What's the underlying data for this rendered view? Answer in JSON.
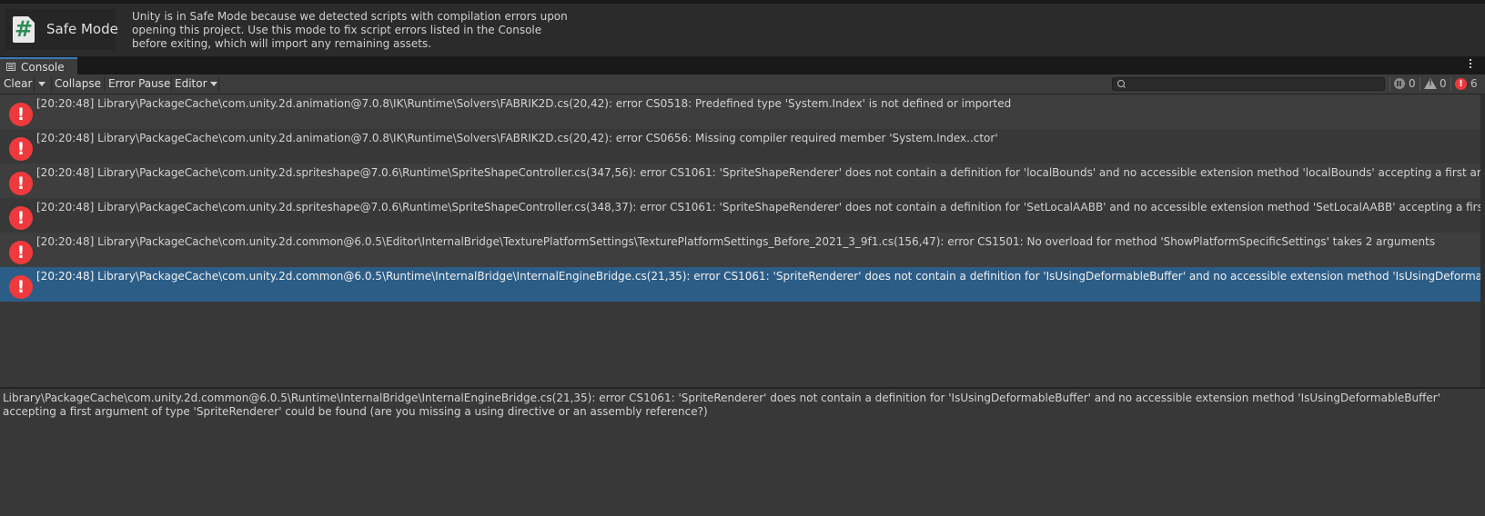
{
  "safe_mode": {
    "title": "Safe Mode",
    "icon": "hash-icon",
    "message_lines": [
      "Unity is in Safe Mode because we detected scripts with compilation errors upon",
      "opening this project. Use this mode to fix script errors listed in the Console",
      "before exiting, which will import any remaining assets."
    ]
  },
  "tab": {
    "label": "Console"
  },
  "toolbar": {
    "clear_label": "Clear",
    "collapse_label": "Collapse",
    "error_pause_label": "Error Pause",
    "editor_label": "Editor",
    "search_placeholder": "",
    "counts": {
      "messages": "0",
      "warnings": "0",
      "errors": "6"
    }
  },
  "log_entries": [
    {
      "text": "[20:20:48] Library\\PackageCache\\com.unity.2d.animation@7.0.8\\IK\\Runtime\\Solvers\\FABRIK2D.cs(20,42): error CS0518: Predefined type 'System.Index' is not defined or imported",
      "type": "error",
      "selected": false
    },
    {
      "text": "[20:20:48] Library\\PackageCache\\com.unity.2d.animation@7.0.8\\IK\\Runtime\\Solvers\\FABRIK2D.cs(20,42): error CS0656: Missing compiler required member 'System.Index..ctor'",
      "type": "error",
      "selected": false
    },
    {
      "text": "[20:20:48] Library\\PackageCache\\com.unity.2d.spriteshape@7.0.6\\Runtime\\SpriteShapeController.cs(347,56): error CS1061: 'SpriteShapeRenderer' does not contain a definition for 'localBounds' and no accessible extension method 'localBounds' accepting a first argument of type 'Spr",
      "type": "error",
      "selected": false
    },
    {
      "text": "[20:20:48] Library\\PackageCache\\com.unity.2d.spriteshape@7.0.6\\Runtime\\SpriteShapeController.cs(348,37): error CS1061: 'SpriteShapeRenderer' does not contain a definition for 'SetLocalAABB' and no accessible extension method 'SetLocalAABB' accepting a first argument of type",
      "type": "error",
      "selected": false
    },
    {
      "text": "[20:20:48] Library\\PackageCache\\com.unity.2d.common@6.0.5\\Editor\\InternalBridge\\TexturePlatformSettings\\TexturePlatformSettings_Before_2021_3_9f1.cs(156,47): error CS1501: No overload for method 'ShowPlatformSpecificSettings' takes 2 arguments",
      "type": "error",
      "selected": false
    },
    {
      "text": "[20:20:48] Library\\PackageCache\\com.unity.2d.common@6.0.5\\Runtime\\InternalBridge\\InternalEngineBridge.cs(21,35): error CS1061: 'SpriteRenderer' does not contain a definition for 'IsUsingDeformableBuffer' and no accessible extension method 'IsUsingDeformableBuffer' accepting",
      "type": "error",
      "selected": true
    }
  ],
  "details": {
    "text": "Library\\PackageCache\\com.unity.2d.common@6.0.5\\Runtime\\InternalBridge\\InternalEngineBridge.cs(21,35): error CS1061: 'SpriteRenderer' does not contain a definition for 'IsUsingDeformableBuffer' and no accessible extension method 'IsUsingDeformableBuffer' accepting a first argument of type 'SpriteRenderer' could be found (are you missing a using directive or an assembly reference?)"
  },
  "colors": {
    "background": "#282828",
    "selected_row": "#2c5d87",
    "error_icon": "#ee3a3c",
    "tab_accent": "#3a79bb"
  }
}
